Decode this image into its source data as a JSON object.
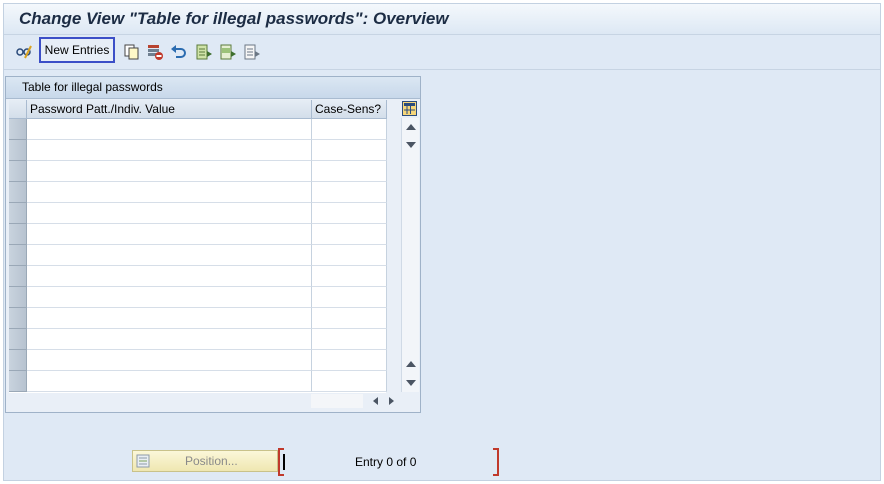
{
  "window": {
    "title": "Change View \"Table for illegal passwords\": Overview"
  },
  "toolbar": {
    "new_entries_label": "New Entries",
    "icons": [
      "display-change-icon",
      "copy-icon",
      "delete-icon",
      "undo-icon",
      "select-all-icon",
      "select-block-icon",
      "deselect-all-icon"
    ]
  },
  "table": {
    "title": "Table for illegal passwords",
    "columns": [
      "Password Patt./Indiv. Value",
      "Case-Sens?"
    ],
    "rows": [
      [
        "",
        ""
      ],
      [
        "",
        ""
      ],
      [
        "",
        ""
      ],
      [
        "",
        ""
      ],
      [
        "",
        ""
      ],
      [
        "",
        ""
      ],
      [
        "",
        ""
      ],
      [
        "",
        ""
      ],
      [
        "",
        ""
      ],
      [
        "",
        ""
      ],
      [
        "",
        ""
      ],
      [
        "",
        ""
      ],
      [
        "",
        ""
      ]
    ]
  },
  "footer": {
    "position_label": "Position...",
    "entry_count": "Entry 0 of 0"
  },
  "colors": {
    "accent_border": "#3c4fc7",
    "background": "#dfe9f5",
    "required_marker": "#c0392b"
  }
}
